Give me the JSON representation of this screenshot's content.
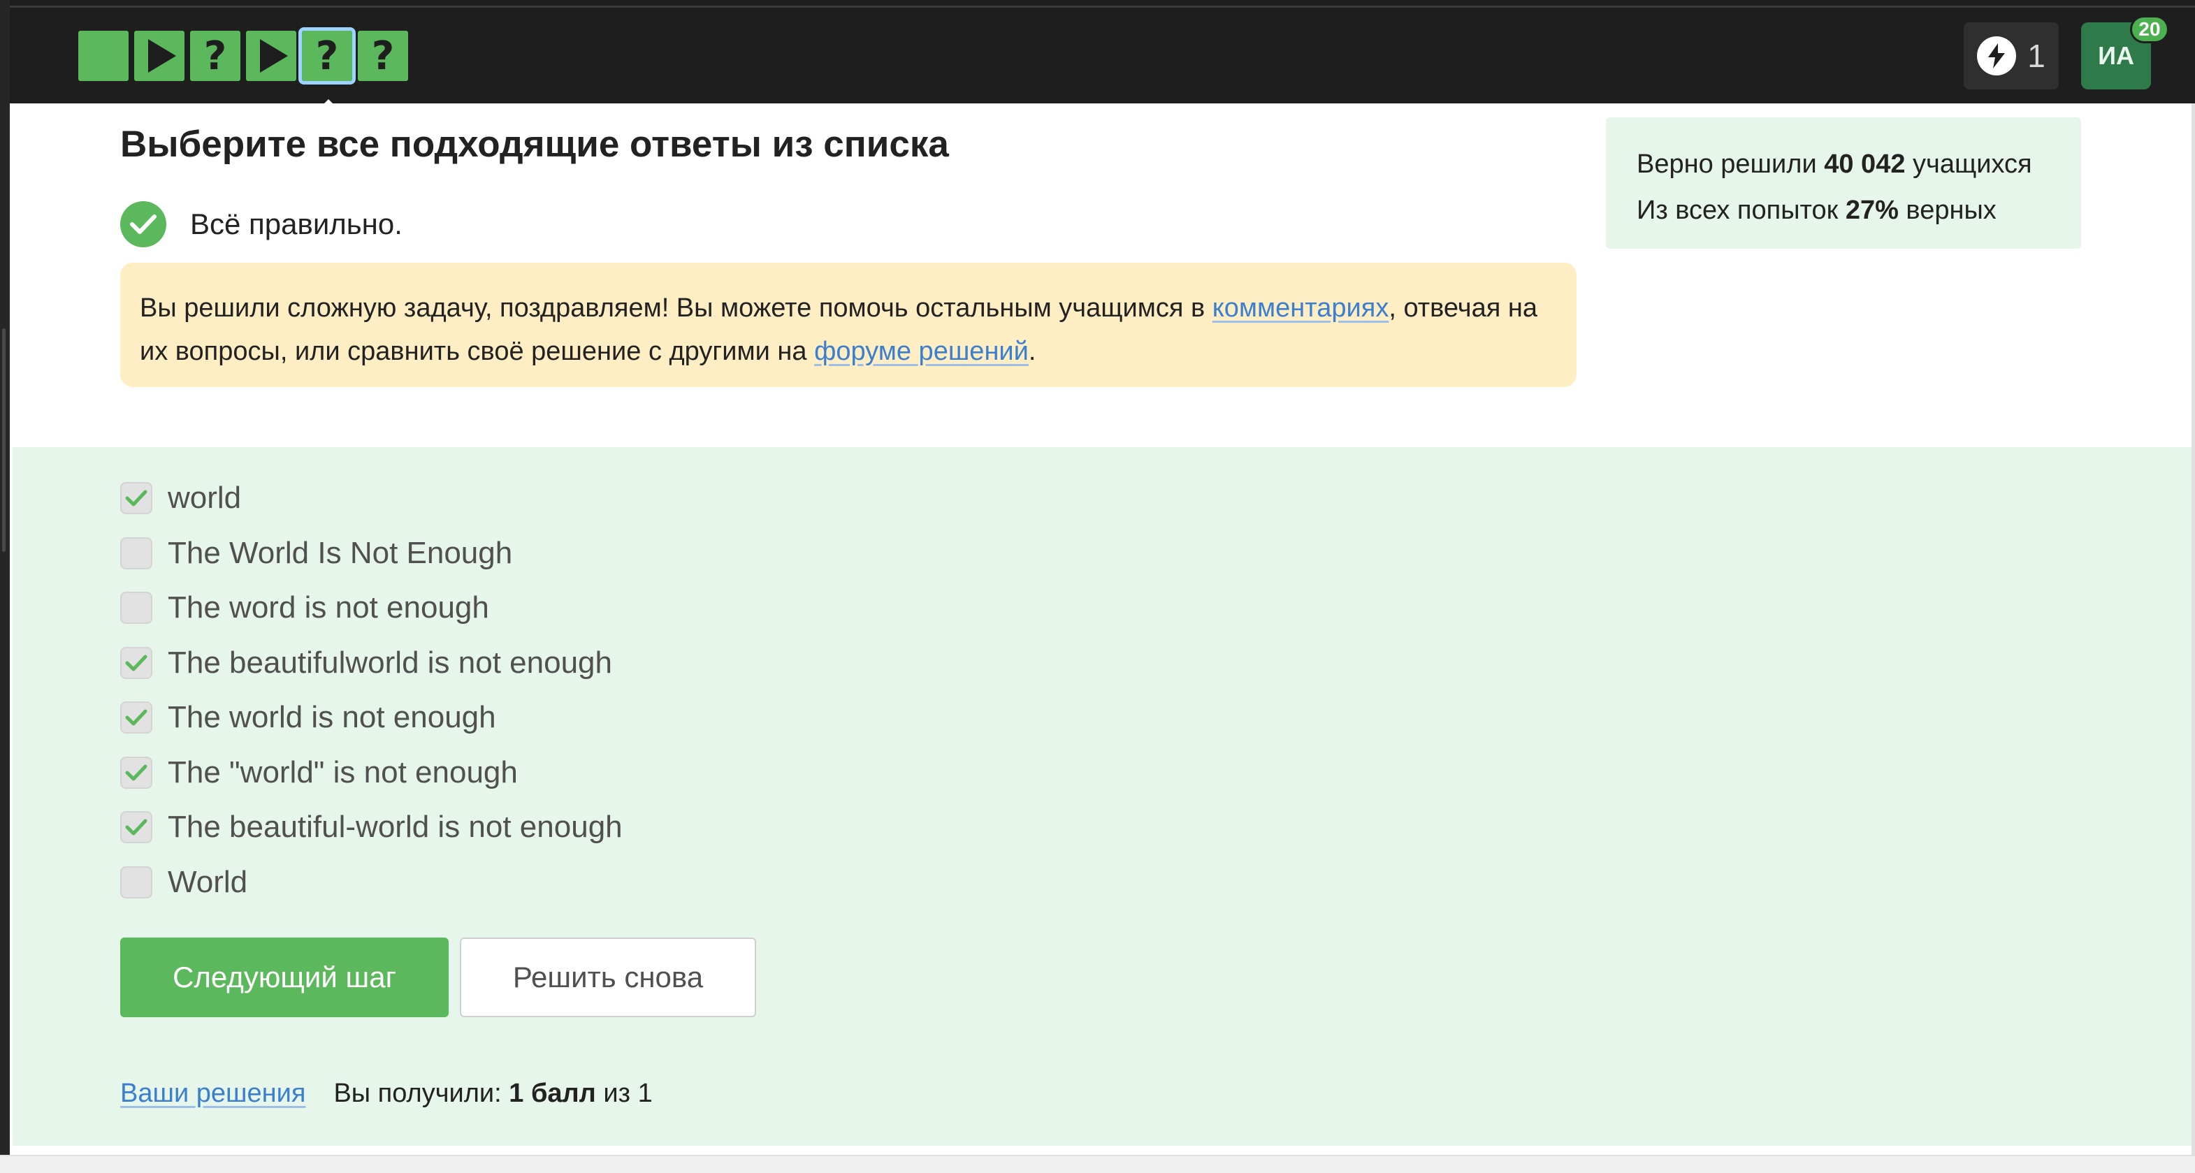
{
  "header": {
    "steps": [
      {
        "kind": "blank",
        "glyph": ""
      },
      {
        "kind": "play",
        "glyph": ""
      },
      {
        "kind": "question",
        "glyph": "?"
      },
      {
        "kind": "play",
        "glyph": ""
      },
      {
        "kind": "question",
        "glyph": "?",
        "active": true
      },
      {
        "kind": "question",
        "glyph": "?"
      }
    ],
    "energy_count": "1",
    "avatar_initials": "ИА",
    "avatar_badge": "20"
  },
  "task": {
    "title": "Выберите все подходящие ответы из списка",
    "status_text": "Всё правильно."
  },
  "notice": {
    "text_1": "Вы решили сложную задачу, поздравляем! Вы можете помочь остальным учащимся в ",
    "link_comments": "комментариях",
    "text_2": ", отвечая на их вопросы, или сравнить своё решение с другими на ",
    "link_forum": "форуме решений",
    "text_3": "."
  },
  "stats": {
    "line1_prefix": "Верно решили ",
    "line1_value": "40 042",
    "line1_suffix": " учащихся",
    "line2_prefix": "Из всех попыток ",
    "line2_value": "27%",
    "line2_suffix": " верных"
  },
  "options": [
    {
      "label": "world",
      "checked": true
    },
    {
      "label": "The World Is Not Enough",
      "checked": false
    },
    {
      "label": "The word is not enough",
      "checked": false
    },
    {
      "label": "The beautifulworld is not enough",
      "checked": true
    },
    {
      "label": "The world is not enough",
      "checked": true
    },
    {
      "label": "The \"world\" is not enough",
      "checked": true
    },
    {
      "label": "The beautiful-world is not enough",
      "checked": true
    },
    {
      "label": "World",
      "checked": false
    }
  ],
  "actions": {
    "next_label": "Следующий шаг",
    "retry_label": "Решить снова"
  },
  "footer": {
    "solutions_link": "Ваши решения",
    "score_prefix": "Вы получили: ",
    "score_value": "1 балл",
    "score_suffix": " из 1"
  },
  "colors": {
    "brand_green": "#5cb85c",
    "link_blue": "#3b7fd0",
    "notice_bg": "#ffeec4",
    "answer_bg": "#e6f6ea"
  }
}
